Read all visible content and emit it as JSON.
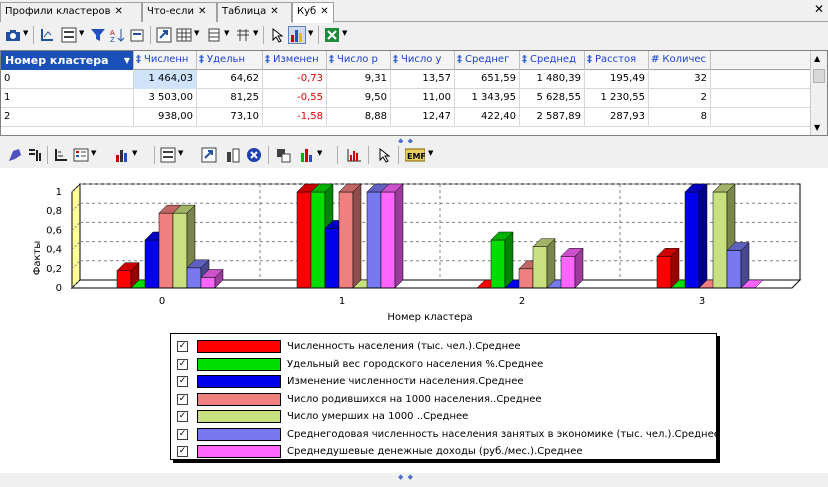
{
  "tabs": [
    {
      "label": "Профили кластеров",
      "active": false
    },
    {
      "label": "Что-если",
      "active": false
    },
    {
      "label": "Таблица",
      "active": false
    },
    {
      "label": "Куб",
      "active": true
    }
  ],
  "grid": {
    "columns": [
      "Номер кластера",
      "Численн",
      "Удельн",
      "Изменен",
      "Число р",
      "Число у",
      "Среднег",
      "Среднед",
      "Расстоя",
      "Количес"
    ],
    "rows": [
      [
        "0",
        "1 464,03",
        "64,62",
        "-0,73",
        "9,31",
        "13,57",
        "651,59",
        "1 480,39",
        "195,49",
        "32"
      ],
      [
        "1",
        "3 503,00",
        "81,25",
        "-0,55",
        "9,50",
        "11,00",
        "1 343,95",
        "5 628,55",
        "1 230,55",
        "2"
      ],
      [
        "2",
        "938,00",
        "73,10",
        "-1,58",
        "8,88",
        "12,47",
        "422,40",
        "2 587,89",
        "287,93",
        "8"
      ]
    ],
    "column_markers": [
      "‡",
      "‡",
      "‡",
      "‡",
      "‡",
      "‡",
      "‡",
      "‡",
      "#"
    ]
  },
  "chart_data": {
    "type": "bar",
    "ylabel": "Факты",
    "xlabel": "Номер кластера",
    "categories": [
      "0",
      "1",
      "2",
      "3"
    ],
    "yticks": [
      "0",
      "0,2",
      "0,4",
      "0,6",
      "0,8",
      "1"
    ],
    "ylim": [
      0,
      1
    ],
    "grid": true,
    "series": [
      {
        "name": "Численность населения (тыс. чел.).Среднее",
        "color": "#ff0000",
        "values": [
          0.18,
          1.0,
          0.0,
          0.33
        ]
      },
      {
        "name": "Удельный вес городского населения %.Среднее",
        "color": "#00dd00",
        "values": [
          0.0,
          1.0,
          0.5,
          0.0
        ]
      },
      {
        "name": "Изменение численности населения.Среднее",
        "color": "#0000ee",
        "values": [
          0.5,
          0.62,
          0.0,
          1.0
        ]
      },
      {
        "name": "Число родившихся на 1000 населения..Среднее",
        "color": "#f08080",
        "values": [
          0.78,
          1.0,
          0.2,
          0.0
        ]
      },
      {
        "name": "Число умерших на 1000 ..Среднее",
        "color": "#c8e080",
        "values": [
          0.78,
          0.0,
          0.43,
          1.0
        ]
      },
      {
        "name": "Среднегодовая численность населения занятых в экономике  (тыс. чел.).Среднее",
        "color": "#7878f0",
        "values": [
          0.21,
          1.0,
          0.0,
          0.39
        ]
      },
      {
        "name": "Среднедушевые денежные доходы (руб./мес.).Среднее",
        "color": "#ff66ff",
        "values": [
          0.11,
          1.0,
          0.33,
          0.0
        ]
      }
    ]
  }
}
